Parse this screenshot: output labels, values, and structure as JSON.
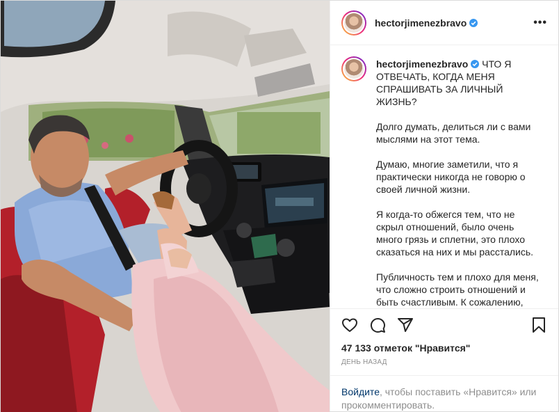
{
  "header": {
    "username": "hectorjimenezbravo",
    "more_icon": "more-horizontal-icon",
    "more_label": "•••"
  },
  "caption": {
    "username": "hectorjimenezbravo",
    "title": "ЧТО Я ОТВЕЧАТЬ, КОГДА МЕНЯ СПРАШИВАТЬ ЗА ЛИЧНЫЙ ЖИЗНЬ?",
    "paragraphs": [
      "Долго думать, делиться ли с вами мыслями на этот тема.",
      "Думаю, многие заметили, что я практически никогда не говорю о своей личной жизни.",
      "Я когда-то обжегся тем, что не скрыл отношений, было очень много грязь и сплетни, это плохо сказаться на них и мы расстались.",
      "Публичность тем и плохо для меня, что сложно строить отношений и быть счастливым. К сожалению,"
    ]
  },
  "actions": {
    "like_icon": "heart-icon",
    "comment_icon": "comment-icon",
    "share_icon": "paper-plane-icon",
    "save_icon": "bookmark-icon"
  },
  "likes": "47 133 отметок \"Нравится\"",
  "time": "день назад",
  "login": {
    "link": "Войдите",
    "rest": ", чтобы поставить «Нравится» или прокомментировать."
  },
  "colors": {
    "link": "#00376b",
    "verified": "#3897f0",
    "muted": "#8e8e8e"
  }
}
